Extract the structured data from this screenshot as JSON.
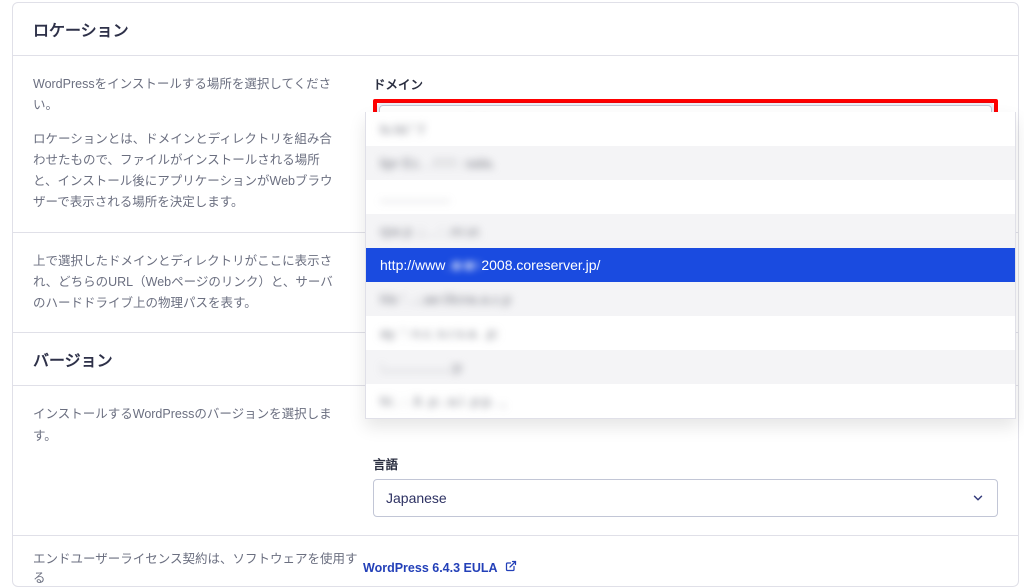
{
  "location": {
    "heading": "ロケーション",
    "lead": "WordPressをインストールする場所を選択してください。",
    "description": "ロケーションとは、ドメインとディレクトリを組み合わせたもので、ファイルがインストールされる場所と、インストール後にアプリケーションがWebブラウザーで表示される場所を決定します。",
    "note": "上で選択したドメインとディレクトリがここに表示され、どちらのURL（Webページのリンク）と、サーバのハードドライブ上の物理パスを表す。",
    "domain_label": "ドメイン",
    "domain_value": "http://www.▇▇▇▇v2008.coreserver.jp/",
    "domain_value_prefix": "http://www.",
    "domain_value_blurred": "pla.lar",
    "domain_value_suffix": "v2008.coreserver.jp/",
    "dropdown": {
      "items": [
        {
          "text": "ls.lsl.\".f",
          "selected": false
        },
        {
          "text": "lipr Ec. . ! ! ! : sala.",
          "selected": false
        },
        {
          "text": "..................",
          "selected": false
        },
        {
          "text": "rpa p .:. . : .nr.ur.",
          "selected": false
        },
        {
          "text": "",
          "selected": true,
          "prefix": "http://www",
          "blurred": ". ■ ■=",
          "suffix": "2008.coreserver.jp/"
        },
        {
          "text": "hls '. .:.ae:0lcna.a.c.p",
          "selected": false
        },
        {
          "text": "ay. ': n.c.:s.r.s.a. .p:",
          "selected": false
        },
        {
          "text": ":.................:p",
          "selected": false
        },
        {
          "text": "hi:. : .lt. p:.:a.l. p:p. .,",
          "selected": false
        }
      ]
    },
    "language_label": "言語",
    "language_value": "Japanese"
  },
  "version": {
    "heading": "バージョン",
    "description": "インストールするWordPressのバージョンを選択します。"
  },
  "footer": {
    "eula_note": "エンドユーザーライセンス契約は、ソフトウェアを使用する",
    "eula_link": "WordPress 6.4.3 EULA"
  }
}
